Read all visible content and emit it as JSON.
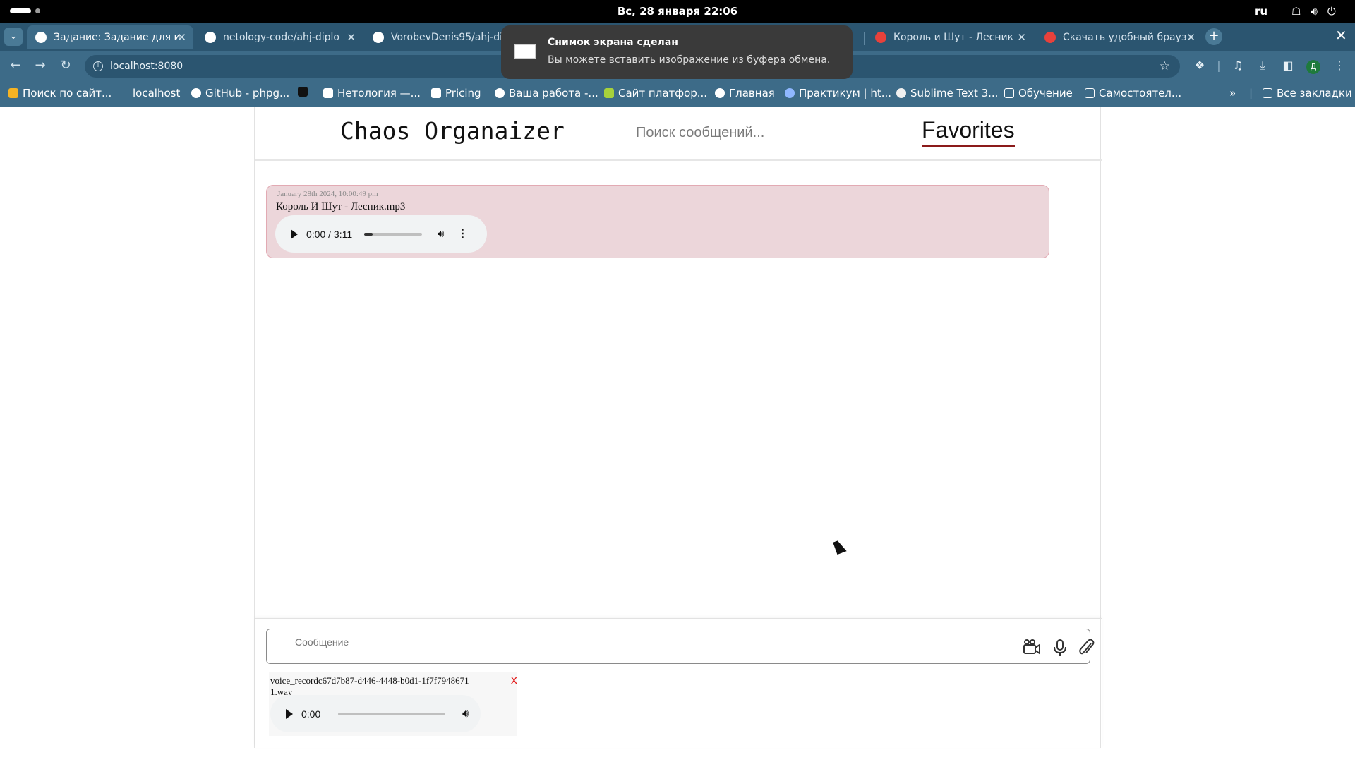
{
  "system_bar": {
    "clock": "Вс, 28 января  22:06",
    "language": "ru"
  },
  "browser": {
    "tabs": [
      {
        "title": "Задание: Задание для и",
        "favicon_color": "#ffffff"
      },
      {
        "title": "netology-code/ahj-diplo",
        "favicon_color": "#ffffff"
      },
      {
        "title": "VorobevDenis95/ahj-di",
        "favicon_color": "#ffffff"
      },
      {
        "title": "Король и Шут - Лесник",
        "favicon_color": "#e8413b"
      },
      {
        "title": "Скачать удобный брауз",
        "favicon_color": "#e8413b"
      }
    ],
    "address": "localhost:8080",
    "bookmarks": [
      "Поиск по сайт...",
      "localhost",
      "GitHub - phpg...",
      "Нетология —...",
      "Pricing",
      "Ваша работа -...",
      "Сайт платфор...",
      "Главная",
      "Практикум | ht...",
      "Sublime Text 3...",
      "Обучение",
      "Самостоятел...",
      "Все закладки"
    ],
    "profile_initial": "Д"
  },
  "notification": {
    "title": "Снимок экрана сделан",
    "body": "Вы можете вставить изображение из буфера обмена."
  },
  "app": {
    "title": "Chaos Organaizer",
    "search_placeholder": "Поиск сообщений...",
    "favorites_label": "Favorites",
    "messages": [
      {
        "timestamp": "January 28th 2024, 10:00:49 pm",
        "file_name": "Король И Шут - Лесник.mp3",
        "audio_time": "0:00 / 3:11",
        "audio_progress": 0.15
      }
    ],
    "composer": {
      "placeholder": "Сообщение",
      "icons": [
        "video-camera-icon",
        "microphone-icon",
        "paperclip-icon"
      ]
    },
    "attachment": {
      "file_name": "voice_recordc67d7b87-d446-4448-b0d1-1f7f79486711.wav",
      "remove_label": "X",
      "audio_time": "0:00",
      "audio_progress": 0
    }
  }
}
